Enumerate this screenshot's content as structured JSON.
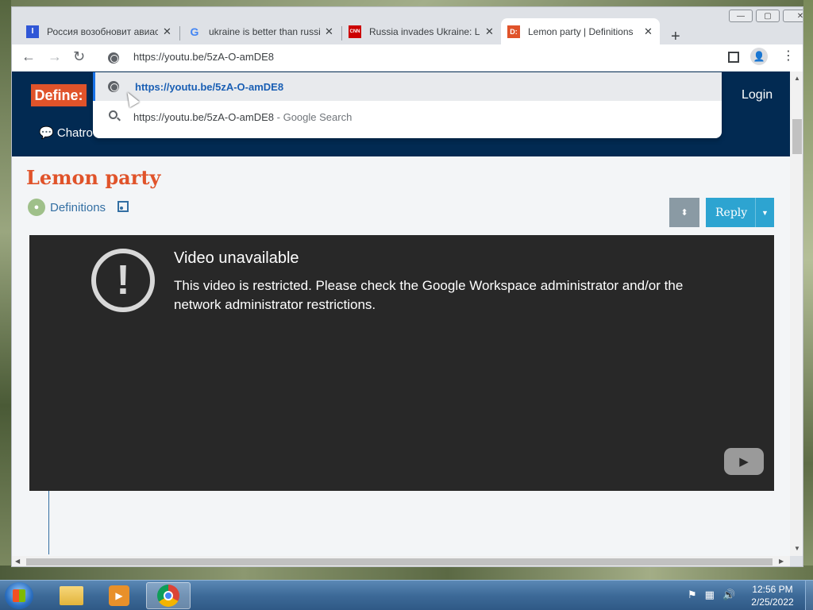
{
  "browser": {
    "tabs": [
      {
        "title": "Россия возобновит авиасообщение",
        "favicon": "I",
        "favicon_color": "#3057d6",
        "close": "✕"
      },
      {
        "title": "ukraine is better than russia",
        "favicon": "G",
        "favicon_color": "#4285f4",
        "close": "✕"
      },
      {
        "title": "Russia invades Ukraine: Live updates",
        "favicon": "CNN",
        "favicon_color": "#cc0000",
        "close": "✕"
      },
      {
        "title": "Lemon party | Definitions",
        "favicon": "D:",
        "favicon_color": "#e0532a",
        "close": "✕",
        "active": true
      }
    ],
    "new_tab": "+",
    "nav": {
      "back": "←",
      "forward": "→",
      "reload": "↻"
    },
    "omnibox": {
      "url": "https://youtu.be/5zA-O-amDE8"
    },
    "suggestions": [
      {
        "text": "https://youtu.be/5zA-O-amDE8",
        "icon": "globe-icon"
      },
      {
        "text": "https://youtu.be/5zA-O-amDE8",
        "suffix": " - Google Search",
        "icon": "search-icon"
      }
    ],
    "window_controls": {
      "minimize": "—",
      "maximize": "▢",
      "close": "✕"
    }
  },
  "site": {
    "logo": "Define:",
    "login": "Login",
    "nav_partial": "Chatro",
    "title": "Lemon party",
    "category": "Definitions",
    "reply": "Reply",
    "reply_caret": "▼",
    "sort_icon": "⬍",
    "colors": {
      "header": "#022a52",
      "accent": "#e0532a",
      "reply": "#2da4d1"
    }
  },
  "video": {
    "heading": "Video unavailable",
    "message": "This video is restricted. Please check the Google Workspace administrator and/or the network administrator restrictions.",
    "bang": "!",
    "play": "▶"
  },
  "taskbar": {
    "time": "12:56 PM",
    "date": "2/25/2022"
  }
}
